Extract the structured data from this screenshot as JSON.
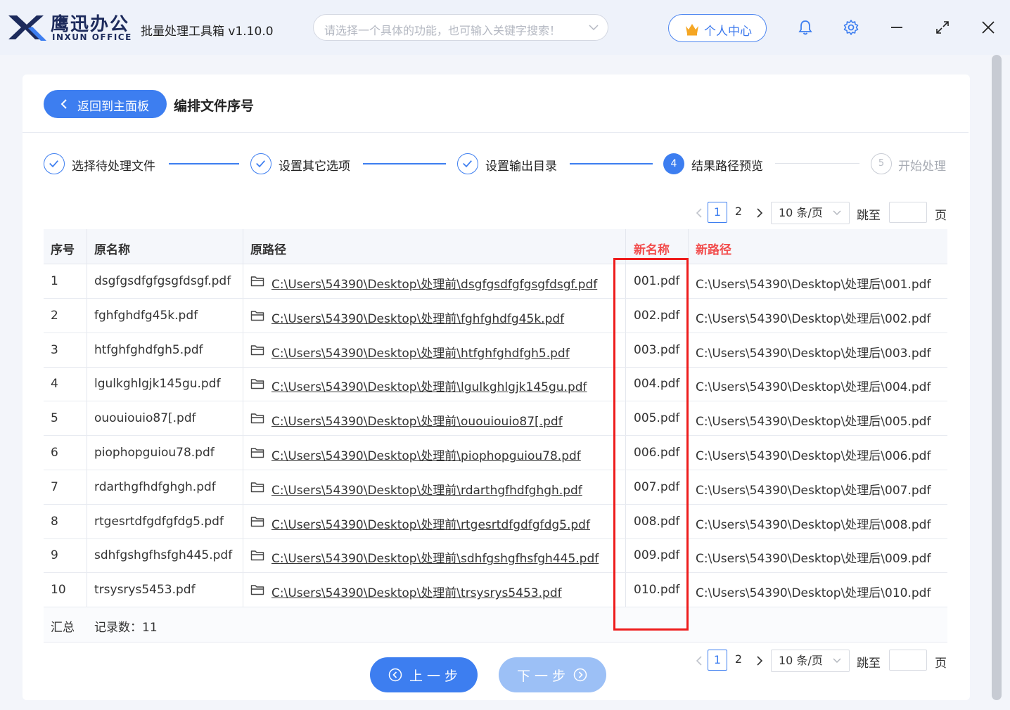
{
  "app": {
    "brand_cn": "鹰迅办公",
    "brand_en": "INXUN OFFICE",
    "title": "批量处理工具箱 v1.10.0",
    "search_placeholder": "请选择一个具体的功能，也可输入关键字搜索！",
    "user_center": "个人中心",
    "accent_color": "#3d7ef0",
    "highlight_color": "#f24c4c"
  },
  "header": {
    "back_label": "返回到主面板",
    "page_title": "编排文件序号"
  },
  "steps": [
    {
      "label": "选择待处理文件",
      "state": "done",
      "number": ""
    },
    {
      "label": "设置其它选项",
      "state": "done",
      "number": ""
    },
    {
      "label": "设置输出目录",
      "state": "done",
      "number": ""
    },
    {
      "label": "结果路径预览",
      "state": "active",
      "number": "4"
    },
    {
      "label": "开始处理",
      "state": "todo",
      "number": "5"
    }
  ],
  "pagination": {
    "pages": [
      "1",
      "2"
    ],
    "current": "1",
    "page_size": "10 条/页",
    "jump_label": "跳至",
    "page_suffix": "页"
  },
  "table": {
    "headers": {
      "index": "序号",
      "orig_name": "原名称",
      "orig_path": "原路径",
      "new_name": "新名称",
      "new_path": "新路径"
    },
    "rows": [
      {
        "index": "1",
        "orig_name": "dsgfgsdfgfgsgfdsgf.pdf",
        "orig_path": "C:\\Users\\54390\\Desktop\\处理前\\dsgfgsdfgfgsgfdsgf.pdf",
        "new_name": "001.pdf",
        "new_path": "C:\\Users\\54390\\Desktop\\处理后\\001.pdf"
      },
      {
        "index": "2",
        "orig_name": "fghfghdfg45k.pdf",
        "orig_path": "C:\\Users\\54390\\Desktop\\处理前\\fghfghdfg45k.pdf",
        "new_name": "002.pdf",
        "new_path": "C:\\Users\\54390\\Desktop\\处理后\\002.pdf"
      },
      {
        "index": "3",
        "orig_name": "htfghfghdfgh5.pdf",
        "orig_path": "C:\\Users\\54390\\Desktop\\处理前\\htfghfghdfgh5.pdf",
        "new_name": "003.pdf",
        "new_path": "C:\\Users\\54390\\Desktop\\处理后\\003.pdf"
      },
      {
        "index": "4",
        "orig_name": "lgulkghlgjk145gu.pdf",
        "orig_path": "C:\\Users\\54390\\Desktop\\处理前\\lgulkghlgjk145gu.pdf",
        "new_name": "004.pdf",
        "new_path": "C:\\Users\\54390\\Desktop\\处理后\\004.pdf"
      },
      {
        "index": "5",
        "orig_name": "ououiouio87[.pdf",
        "orig_path": "C:\\Users\\54390\\Desktop\\处理前\\ououiouio87[.pdf",
        "new_name": "005.pdf",
        "new_path": "C:\\Users\\54390\\Desktop\\处理后\\005.pdf"
      },
      {
        "index": "6",
        "orig_name": "piophopguiou78.pdf",
        "orig_path": "C:\\Users\\54390\\Desktop\\处理前\\piophopguiou78.pdf",
        "new_name": "006.pdf",
        "new_path": "C:\\Users\\54390\\Desktop\\处理后\\006.pdf"
      },
      {
        "index": "7",
        "orig_name": "rdarthgfhdfghgh.pdf",
        "orig_path": "C:\\Users\\54390\\Desktop\\处理前\\rdarthgfhdfghgh.pdf",
        "new_name": "007.pdf",
        "new_path": "C:\\Users\\54390\\Desktop\\处理后\\007.pdf"
      },
      {
        "index": "8",
        "orig_name": "rtgesrtdfgdfgfdg5.pdf",
        "orig_path": "C:\\Users\\54390\\Desktop\\处理前\\rtgesrtdfgdfgfdg5.pdf",
        "new_name": "008.pdf",
        "new_path": "C:\\Users\\54390\\Desktop\\处理后\\008.pdf"
      },
      {
        "index": "9",
        "orig_name": "sdhfgshgfhsfgh445.pdf",
        "orig_path": "C:\\Users\\54390\\Desktop\\处理前\\sdhfgshgfhsfgh445.pdf",
        "new_name": "009.pdf",
        "new_path": "C:\\Users\\54390\\Desktop\\处理后\\009.pdf"
      },
      {
        "index": "10",
        "orig_name": "trsysrys5453.pdf",
        "orig_path": "C:\\Users\\54390\\Desktop\\处理前\\trsysrys5453.pdf",
        "new_name": "010.pdf",
        "new_path": "C:\\Users\\54390\\Desktop\\处理后\\010.pdf"
      }
    ],
    "summary_label": "汇总",
    "summary_count": "记录数：11"
  },
  "footer": {
    "prev_label": "上一步",
    "next_label": "下一步"
  }
}
